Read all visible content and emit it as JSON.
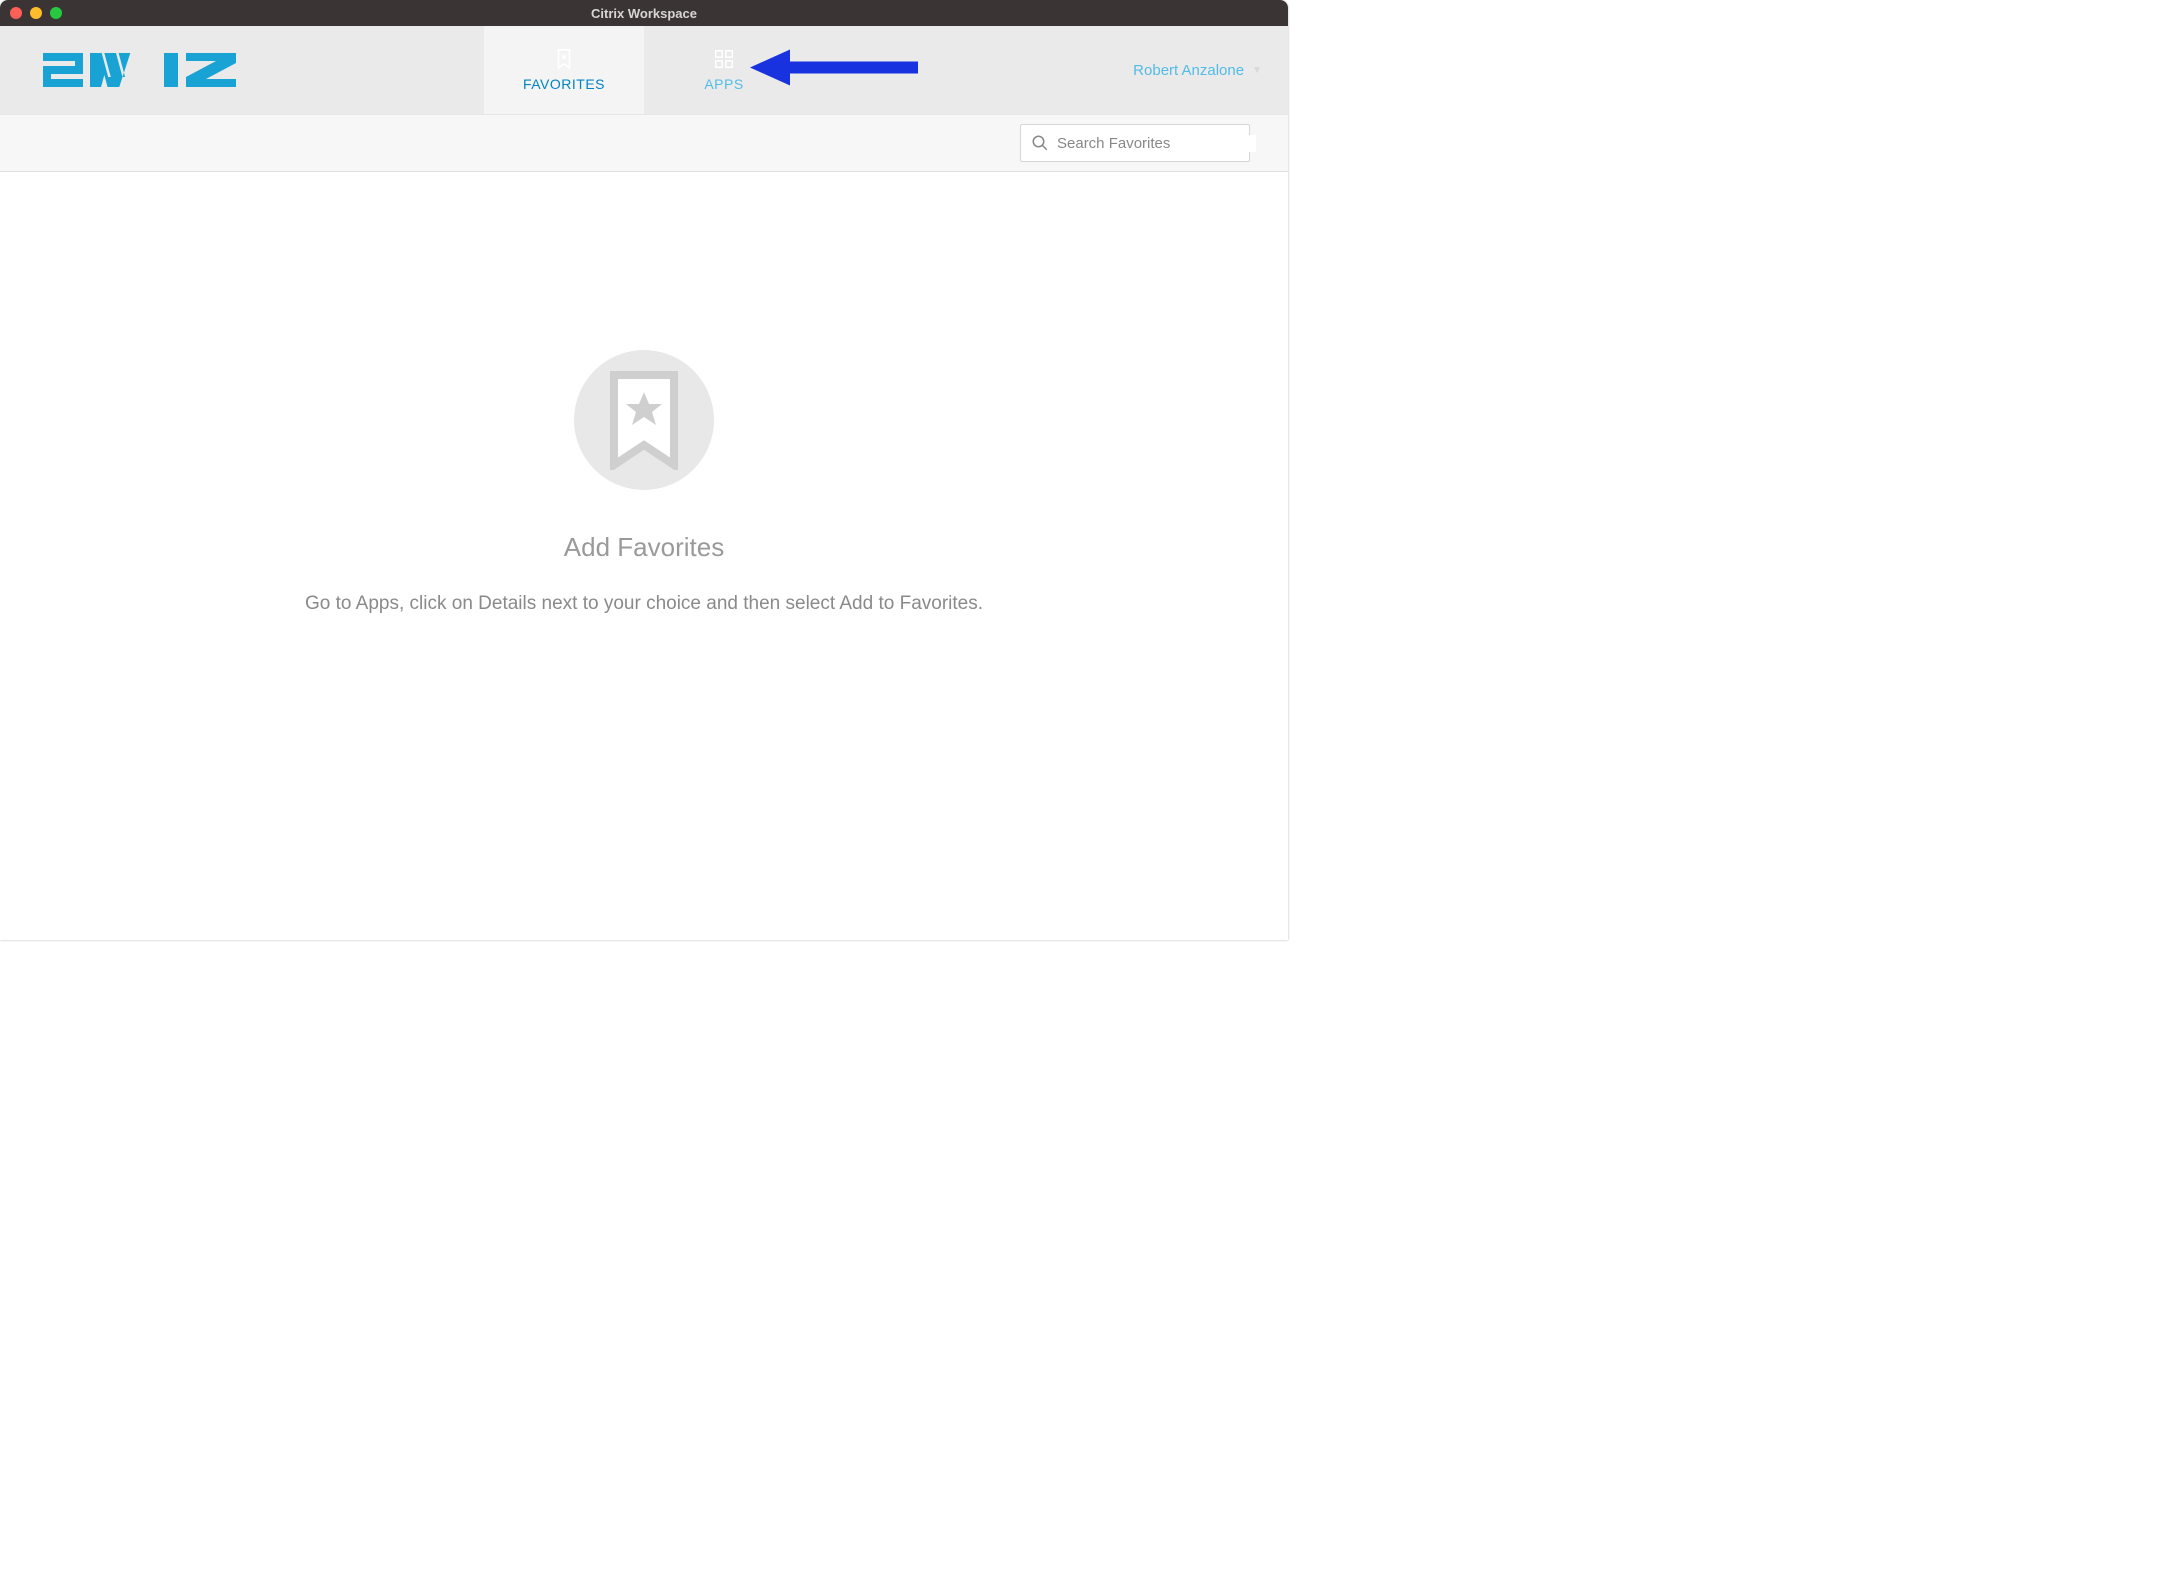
{
  "window": {
    "title": "Citrix Workspace"
  },
  "header": {
    "logo_text": "SWIZ",
    "tabs": [
      {
        "label": "FAVORITES",
        "active": true
      },
      {
        "label": "APPS",
        "active": false
      }
    ],
    "user_name": "Robert Anzalone"
  },
  "search": {
    "placeholder": "Search Favorites"
  },
  "empty_state": {
    "title": "Add Favorites",
    "subtitle": "Go to Apps, click on Details next to your choice and then select Add to Favorites."
  },
  "annotation": {
    "arrow_target": "APPS tab"
  }
}
